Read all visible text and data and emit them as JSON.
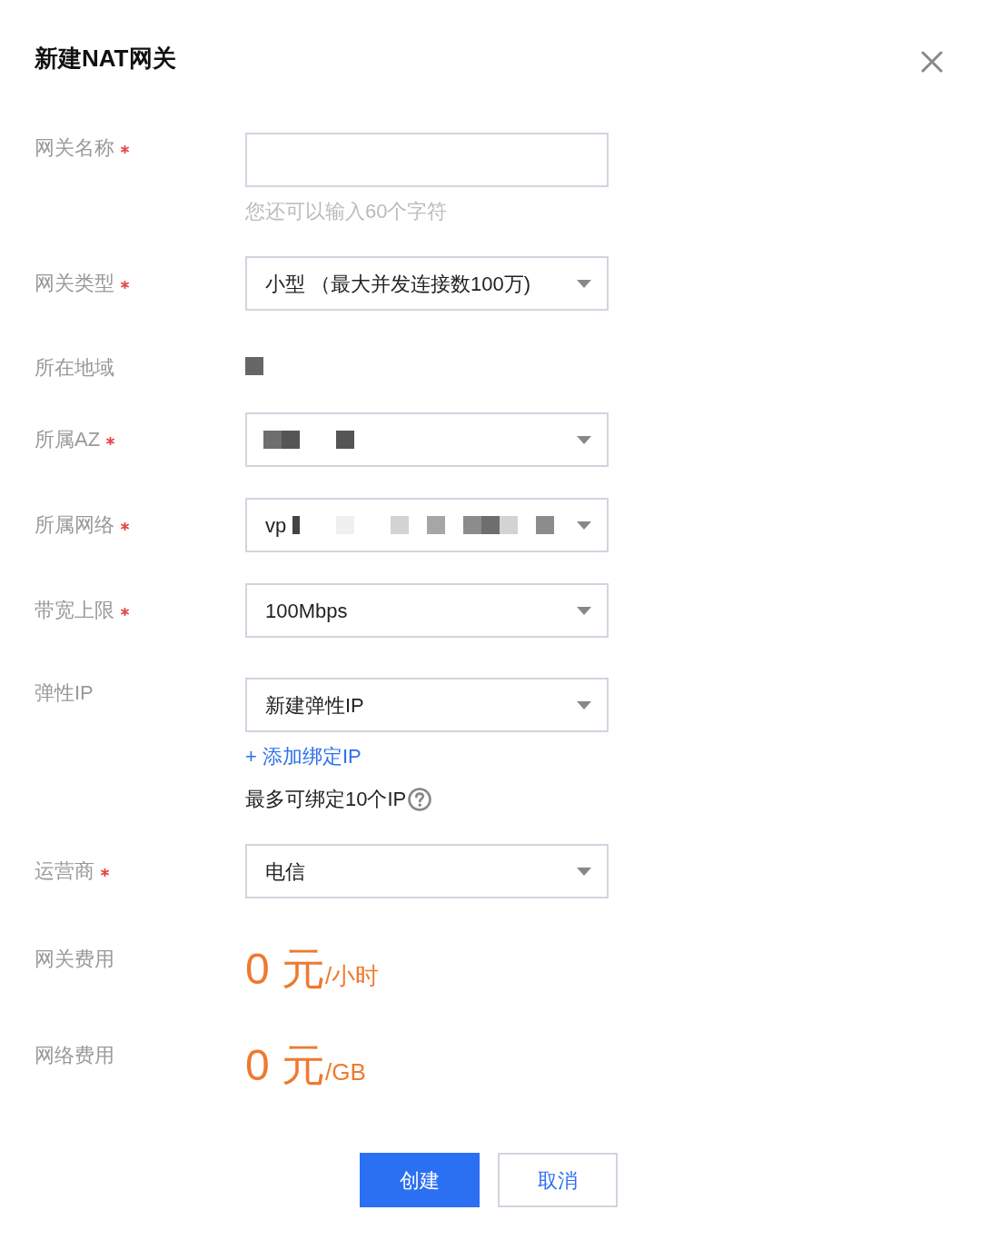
{
  "dialog": {
    "title": "新建NAT网关"
  },
  "fields": [
    {
      "label": "网关名称",
      "required": true,
      "kind": "input",
      "redacted": false,
      "hint": "您还可以输入60个字符"
    },
    {
      "label": "网关类型",
      "required": true,
      "kind": "select",
      "redacted": false,
      "value": "小型 （最大并发连接数100万)"
    },
    {
      "label": "所在地域",
      "required": false,
      "kind": "text",
      "redacted": true
    },
    {
      "label": "所属AZ",
      "required": true,
      "kind": "select",
      "redacted": true
    },
    {
      "label": "所属网络",
      "required": true,
      "kind": "select",
      "redacted": true,
      "value": "vp"
    },
    {
      "label": "带宽上限",
      "required": true,
      "kind": "select",
      "redacted": false,
      "value": "100Mbps"
    },
    {
      "label": "弹性IP",
      "required": false,
      "kind": "select",
      "redacted": false,
      "value": "新建弹性IP",
      "link": "+ 添加绑定IP",
      "note": "最多可绑定10个IP"
    },
    {
      "label": "运营商",
      "required": true,
      "kind": "select",
      "redacted": false,
      "value": "电信"
    },
    {
      "label": "网关费用",
      "required": false,
      "kind": "price",
      "redacted": false,
      "amount": "0 元",
      "unit": "/小时"
    },
    {
      "label": "网络费用",
      "required": false,
      "kind": "price",
      "redacted": false,
      "amount": "0 元",
      "unit": "/GB"
    }
  ],
  "buttons": [
    {
      "label": "创建",
      "kind": "primary"
    },
    {
      "label": "取消",
      "kind": "secondary"
    }
  ]
}
